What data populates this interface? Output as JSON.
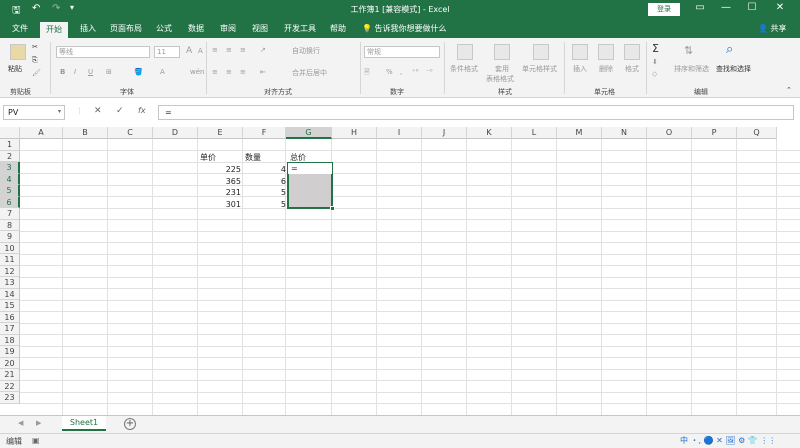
{
  "titlebar": {
    "title": "工作簿1 [兼容模式] - Excel",
    "login_label": "登录",
    "quick_access": {
      "save": "🖫",
      "undo": "↶",
      "redo": "↷",
      "customize": "▾"
    },
    "window_controls": {
      "ribbon_display": "▭",
      "minimize": "—",
      "maximize": "☐",
      "close": "✕"
    }
  },
  "tabs": [
    "文件",
    "开始",
    "插入",
    "页面布局",
    "公式",
    "数据",
    "审阅",
    "视图",
    "开发工具",
    "帮助"
  ],
  "active_tab": "开始",
  "tell_me": "告诉我你想要做什么",
  "share": "共享",
  "ribbon": {
    "clipboard": {
      "label": "剪贴板",
      "paste": "粘贴"
    },
    "font": {
      "label": "字体",
      "font_name": "等线",
      "font_size": "11",
      "bold": "B",
      "italic": "I",
      "underline": "U",
      "grow": "A",
      "shrink": "A",
      "wen": "wén"
    },
    "alignment": {
      "label": "对齐方式",
      "wrap": "自动换行",
      "merge": "合并后居中"
    },
    "number": {
      "label": "数字",
      "format": "常规",
      "percent": "%",
      "comma": ","
    },
    "styles": {
      "label": "样式",
      "conditional": "条件格式",
      "table": "套用",
      "table2": "表格格式",
      "cell_styles": "单元格样式"
    },
    "cells": {
      "label": "单元格",
      "insert": "插入",
      "delete": "删除",
      "format": "格式"
    },
    "editing": {
      "label": "编辑",
      "sort": "排序和筛选",
      "find": "查找和选择",
      "sum": "Σ"
    }
  },
  "formula_bar": {
    "name_box": "PV",
    "cancel": "✕",
    "enter": "✓",
    "fx": "fx",
    "value": "="
  },
  "columns": [
    "A",
    "B",
    "C",
    "D",
    "E",
    "F",
    "G",
    "H",
    "I",
    "J",
    "K",
    "L",
    "M",
    "N",
    "O",
    "P",
    "Q"
  ],
  "rows": [
    "1",
    "2",
    "3",
    "4",
    "5",
    "6",
    "7",
    "8",
    "9",
    "10",
    "11",
    "12",
    "13",
    "14",
    "15",
    "16",
    "17",
    "18",
    "19",
    "20",
    "21",
    "22",
    "23"
  ],
  "cells": {
    "E2": "单价",
    "F2": "数量",
    "G2": "总价",
    "E3": "225",
    "F3": "4",
    "E4": "365",
    "F4": "6",
    "E5": "231",
    "F5": "5",
    "E6": "301",
    "F6": "5",
    "G3": "="
  },
  "sheets": [
    "Sheet1"
  ],
  "add_sheet": "+",
  "status": {
    "mode": "编辑",
    "ime": "中 ・, 🔵 ✕ 🖼 ⚙ 👕 ⋮⋮"
  },
  "colors": {
    "accent": "#217346",
    "selection_fill": "#d0cece"
  }
}
